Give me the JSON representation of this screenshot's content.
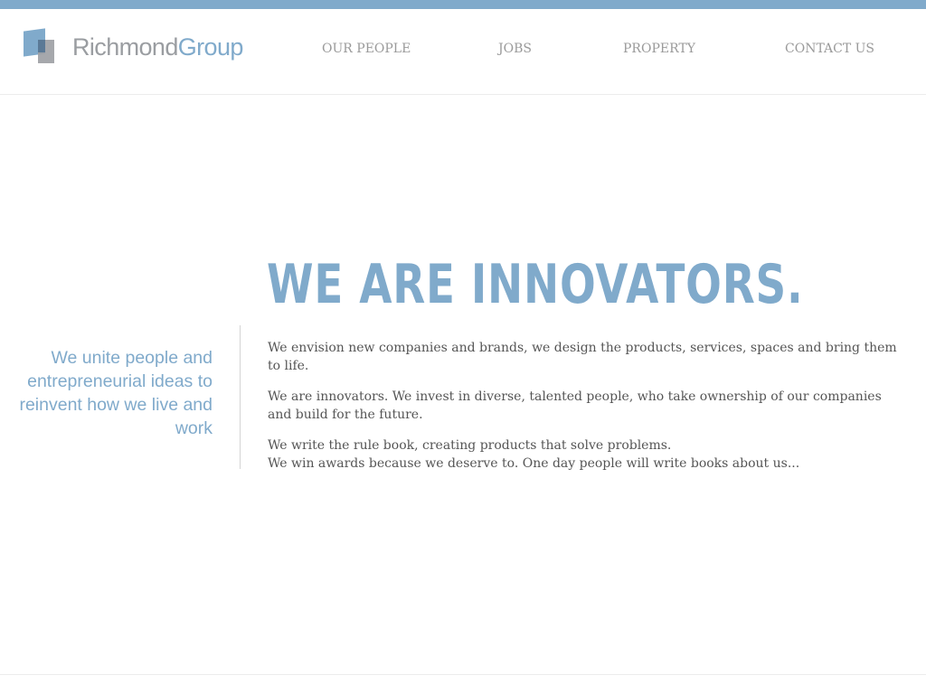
{
  "brand": {
    "name_part1": "Richmond",
    "name_part2": "Group",
    "accent_color": "#80aacb",
    "grey_color": "#9a9da1",
    "logo_icon": "overlapping-squares-logo-icon"
  },
  "nav": {
    "items": [
      {
        "label": "OUR PEOPLE"
      },
      {
        "label": "JOBS"
      },
      {
        "label": "PROPERTY"
      },
      {
        "label": "CONTACT US"
      }
    ]
  },
  "hero": {
    "headline": "WE ARE INNOVATORS.",
    "tagline": "We unite people and entrepreneurial ideas to reinvent how we live and work",
    "paragraphs": [
      "We envision new companies and brands, we design the products, services, spaces and bring them to life.",
      "We are innovators. We invest in diverse, talented people, who take ownership of our companies and build for the future."
    ],
    "closing_lines": [
      "We write the rule book, creating products that solve problems.",
      "We win awards because we deserve to. One day people will write books about us..."
    ]
  }
}
